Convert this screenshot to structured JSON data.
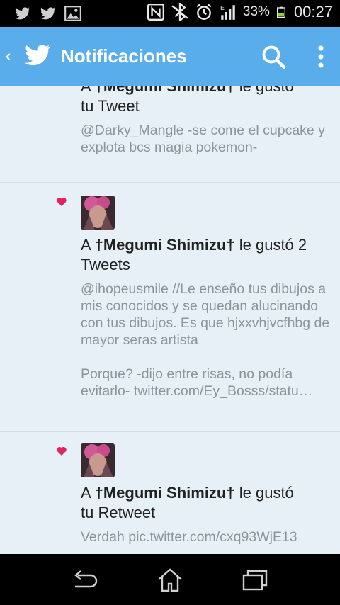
{
  "status_bar": {
    "battery_percent": "33%",
    "time": "00:27",
    "icons": [
      "twitter-notification-icon",
      "twitter-notification-icon",
      "image-notification-icon",
      "nfc-icon",
      "bluetooth-icon",
      "alarm-icon",
      "signal-icon",
      "battery-icon"
    ]
  },
  "action_bar": {
    "title": "Notificaciones",
    "accent_color": "#59adeb"
  },
  "notifications": [
    {
      "headline_prefix": "A ",
      "user": "†Megumi Shimizu†",
      "headline_suffix": " le gustó",
      "headline_line2": "tu Tweet",
      "tweet_text": "@Darky_Mangle -se come el cupcake y explota bcs magia pokemon-"
    },
    {
      "headline_prefix": "A ",
      "user": "†Megumi Shimizu†",
      "headline_suffix": " le gustó 2",
      "headline_line2": "Tweets",
      "tweet_text": "@ihopeusmile //Le enseño tus dibujos a mis conocidos y se quedan alucinando con tus dibujos. Es que hjxxvhjvcfhbg de mayor seras artista",
      "tweet_text_2": "Porque? -dijo entre risas, no podía evitarlo- twitter.com/Ey_Bosss/statu…"
    },
    {
      "headline_prefix": "A ",
      "user": "†Megumi Shimizu†",
      "headline_suffix": " le gustó",
      "headline_line2": "tu Retweet",
      "tweet_text": "Verdah pic.twitter.com/cxq93WjE13"
    }
  ],
  "colors": {
    "heart": "#e0245e",
    "content_background": "#e6f0f6",
    "muted_text": "#8c959b"
  }
}
